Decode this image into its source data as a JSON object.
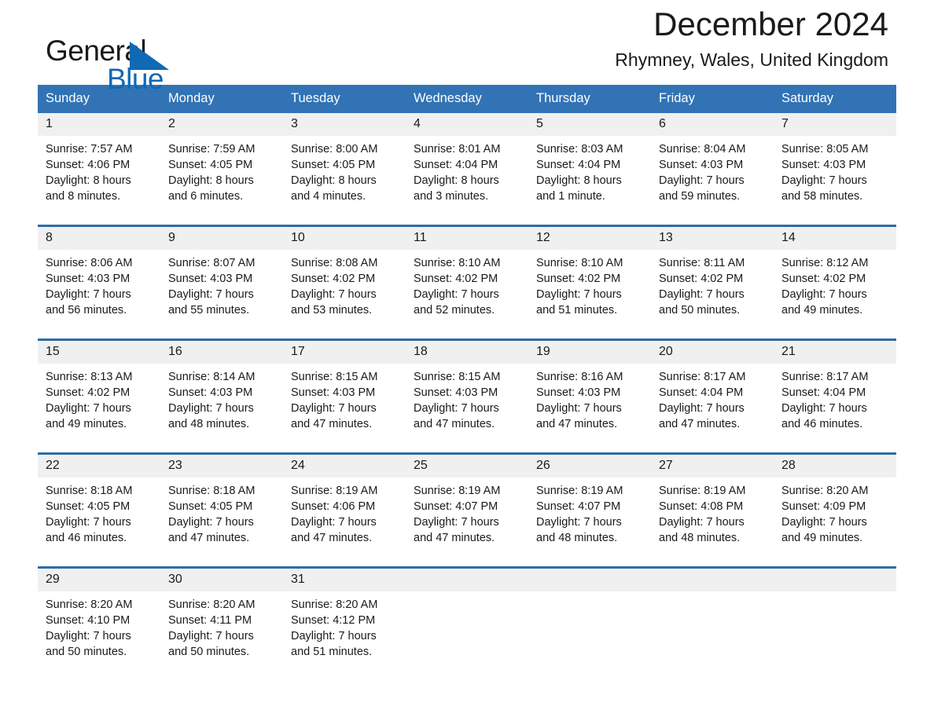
{
  "brand": {
    "name_part1": "General",
    "name_part2": "Blue",
    "triangle_color": "#1069b4"
  },
  "header": {
    "title": "December 2024",
    "location": "Rhymney, Wales, United Kingdom"
  },
  "theme": {
    "header_blue": "#3273b5",
    "row_border_blue": "#2e6da4",
    "daynum_band": "#f0f0f0",
    "text": "#1a1a1a"
  },
  "weekdays": [
    "Sunday",
    "Monday",
    "Tuesday",
    "Wednesday",
    "Thursday",
    "Friday",
    "Saturday"
  ],
  "weeks": [
    [
      {
        "day": "1",
        "sunrise": "Sunrise: 7:57 AM",
        "sunset": "Sunset: 4:06 PM",
        "daylight1": "Daylight: 8 hours",
        "daylight2": "and 8 minutes."
      },
      {
        "day": "2",
        "sunrise": "Sunrise: 7:59 AM",
        "sunset": "Sunset: 4:05 PM",
        "daylight1": "Daylight: 8 hours",
        "daylight2": "and 6 minutes."
      },
      {
        "day": "3",
        "sunrise": "Sunrise: 8:00 AM",
        "sunset": "Sunset: 4:05 PM",
        "daylight1": "Daylight: 8 hours",
        "daylight2": "and 4 minutes."
      },
      {
        "day": "4",
        "sunrise": "Sunrise: 8:01 AM",
        "sunset": "Sunset: 4:04 PM",
        "daylight1": "Daylight: 8 hours",
        "daylight2": "and 3 minutes."
      },
      {
        "day": "5",
        "sunrise": "Sunrise: 8:03 AM",
        "sunset": "Sunset: 4:04 PM",
        "daylight1": "Daylight: 8 hours",
        "daylight2": "and 1 minute."
      },
      {
        "day": "6",
        "sunrise": "Sunrise: 8:04 AM",
        "sunset": "Sunset: 4:03 PM",
        "daylight1": "Daylight: 7 hours",
        "daylight2": "and 59 minutes."
      },
      {
        "day": "7",
        "sunrise": "Sunrise: 8:05 AM",
        "sunset": "Sunset: 4:03 PM",
        "daylight1": "Daylight: 7 hours",
        "daylight2": "and 58 minutes."
      }
    ],
    [
      {
        "day": "8",
        "sunrise": "Sunrise: 8:06 AM",
        "sunset": "Sunset: 4:03 PM",
        "daylight1": "Daylight: 7 hours",
        "daylight2": "and 56 minutes."
      },
      {
        "day": "9",
        "sunrise": "Sunrise: 8:07 AM",
        "sunset": "Sunset: 4:03 PM",
        "daylight1": "Daylight: 7 hours",
        "daylight2": "and 55 minutes."
      },
      {
        "day": "10",
        "sunrise": "Sunrise: 8:08 AM",
        "sunset": "Sunset: 4:02 PM",
        "daylight1": "Daylight: 7 hours",
        "daylight2": "and 53 minutes."
      },
      {
        "day": "11",
        "sunrise": "Sunrise: 8:10 AM",
        "sunset": "Sunset: 4:02 PM",
        "daylight1": "Daylight: 7 hours",
        "daylight2": "and 52 minutes."
      },
      {
        "day": "12",
        "sunrise": "Sunrise: 8:10 AM",
        "sunset": "Sunset: 4:02 PM",
        "daylight1": "Daylight: 7 hours",
        "daylight2": "and 51 minutes."
      },
      {
        "day": "13",
        "sunrise": "Sunrise: 8:11 AM",
        "sunset": "Sunset: 4:02 PM",
        "daylight1": "Daylight: 7 hours",
        "daylight2": "and 50 minutes."
      },
      {
        "day": "14",
        "sunrise": "Sunrise: 8:12 AM",
        "sunset": "Sunset: 4:02 PM",
        "daylight1": "Daylight: 7 hours",
        "daylight2": "and 49 minutes."
      }
    ],
    [
      {
        "day": "15",
        "sunrise": "Sunrise: 8:13 AM",
        "sunset": "Sunset: 4:02 PM",
        "daylight1": "Daylight: 7 hours",
        "daylight2": "and 49 minutes."
      },
      {
        "day": "16",
        "sunrise": "Sunrise: 8:14 AM",
        "sunset": "Sunset: 4:03 PM",
        "daylight1": "Daylight: 7 hours",
        "daylight2": "and 48 minutes."
      },
      {
        "day": "17",
        "sunrise": "Sunrise: 8:15 AM",
        "sunset": "Sunset: 4:03 PM",
        "daylight1": "Daylight: 7 hours",
        "daylight2": "and 47 minutes."
      },
      {
        "day": "18",
        "sunrise": "Sunrise: 8:15 AM",
        "sunset": "Sunset: 4:03 PM",
        "daylight1": "Daylight: 7 hours",
        "daylight2": "and 47 minutes."
      },
      {
        "day": "19",
        "sunrise": "Sunrise: 8:16 AM",
        "sunset": "Sunset: 4:03 PM",
        "daylight1": "Daylight: 7 hours",
        "daylight2": "and 47 minutes."
      },
      {
        "day": "20",
        "sunrise": "Sunrise: 8:17 AM",
        "sunset": "Sunset: 4:04 PM",
        "daylight1": "Daylight: 7 hours",
        "daylight2": "and 47 minutes."
      },
      {
        "day": "21",
        "sunrise": "Sunrise: 8:17 AM",
        "sunset": "Sunset: 4:04 PM",
        "daylight1": "Daylight: 7 hours",
        "daylight2": "and 46 minutes."
      }
    ],
    [
      {
        "day": "22",
        "sunrise": "Sunrise: 8:18 AM",
        "sunset": "Sunset: 4:05 PM",
        "daylight1": "Daylight: 7 hours",
        "daylight2": "and 46 minutes."
      },
      {
        "day": "23",
        "sunrise": "Sunrise: 8:18 AM",
        "sunset": "Sunset: 4:05 PM",
        "daylight1": "Daylight: 7 hours",
        "daylight2": "and 47 minutes."
      },
      {
        "day": "24",
        "sunrise": "Sunrise: 8:19 AM",
        "sunset": "Sunset: 4:06 PM",
        "daylight1": "Daylight: 7 hours",
        "daylight2": "and 47 minutes."
      },
      {
        "day": "25",
        "sunrise": "Sunrise: 8:19 AM",
        "sunset": "Sunset: 4:07 PM",
        "daylight1": "Daylight: 7 hours",
        "daylight2": "and 47 minutes."
      },
      {
        "day": "26",
        "sunrise": "Sunrise: 8:19 AM",
        "sunset": "Sunset: 4:07 PM",
        "daylight1": "Daylight: 7 hours",
        "daylight2": "and 48 minutes."
      },
      {
        "day": "27",
        "sunrise": "Sunrise: 8:19 AM",
        "sunset": "Sunset: 4:08 PM",
        "daylight1": "Daylight: 7 hours",
        "daylight2": "and 48 minutes."
      },
      {
        "day": "28",
        "sunrise": "Sunrise: 8:20 AM",
        "sunset": "Sunset: 4:09 PM",
        "daylight1": "Daylight: 7 hours",
        "daylight2": "and 49 minutes."
      }
    ],
    [
      {
        "day": "29",
        "sunrise": "Sunrise: 8:20 AM",
        "sunset": "Sunset: 4:10 PM",
        "daylight1": "Daylight: 7 hours",
        "daylight2": "and 50 minutes."
      },
      {
        "day": "30",
        "sunrise": "Sunrise: 8:20 AM",
        "sunset": "Sunset: 4:11 PM",
        "daylight1": "Daylight: 7 hours",
        "daylight2": "and 50 minutes."
      },
      {
        "day": "31",
        "sunrise": "Sunrise: 8:20 AM",
        "sunset": "Sunset: 4:12 PM",
        "daylight1": "Daylight: 7 hours",
        "daylight2": "and 51 minutes."
      },
      {
        "day": "",
        "sunrise": "",
        "sunset": "",
        "daylight1": "",
        "daylight2": ""
      },
      {
        "day": "",
        "sunrise": "",
        "sunset": "",
        "daylight1": "",
        "daylight2": ""
      },
      {
        "day": "",
        "sunrise": "",
        "sunset": "",
        "daylight1": "",
        "daylight2": ""
      },
      {
        "day": "",
        "sunrise": "",
        "sunset": "",
        "daylight1": "",
        "daylight2": ""
      }
    ]
  ]
}
